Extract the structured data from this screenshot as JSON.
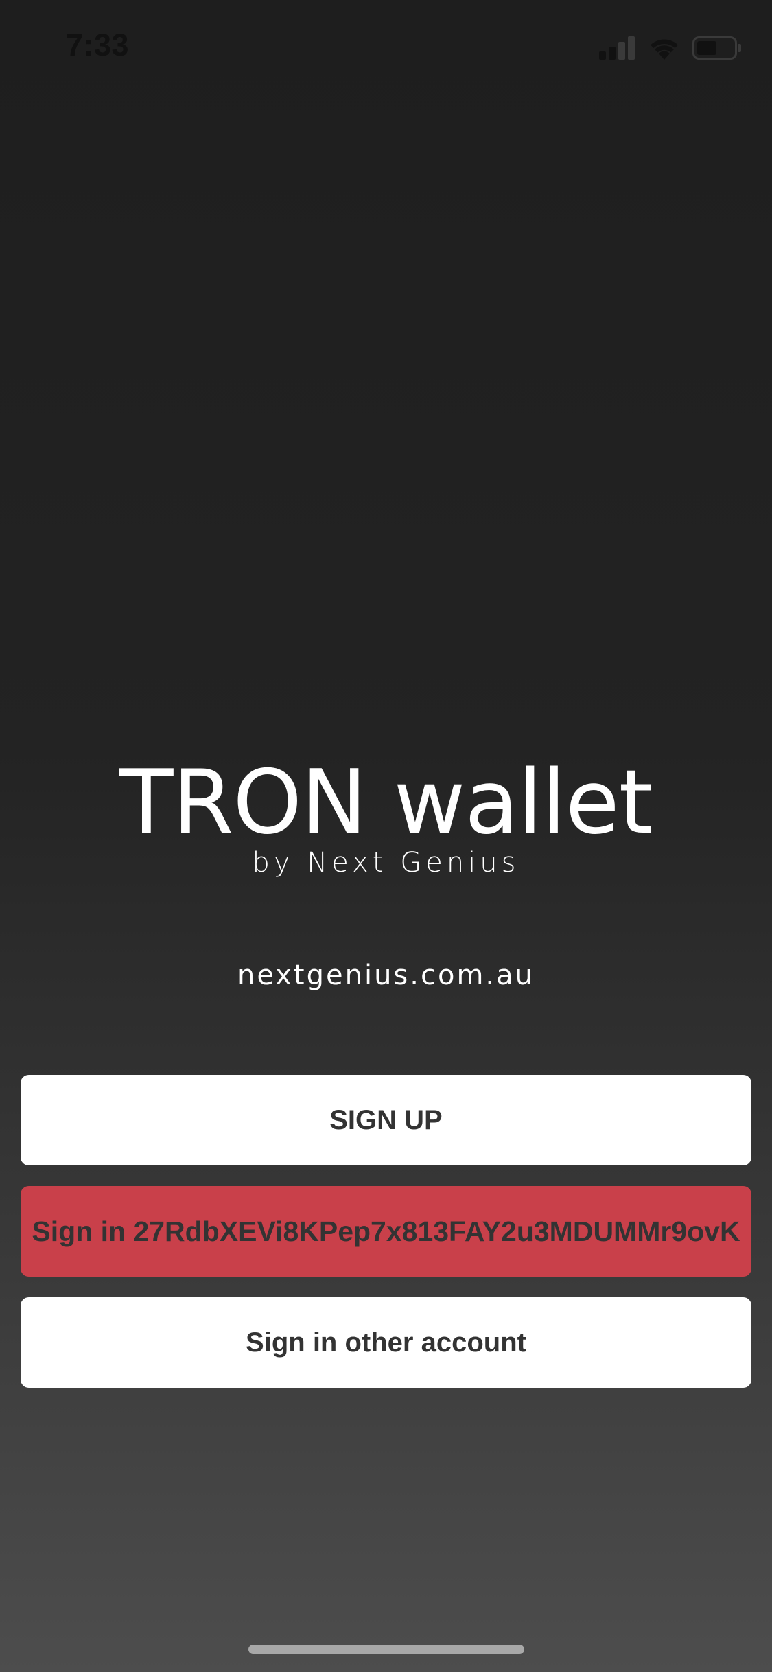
{
  "status_bar": {
    "time": "7:33",
    "icons": [
      "signal-icon",
      "wifi-icon",
      "battery-icon"
    ]
  },
  "brand": {
    "title": "TRON wallet",
    "subtitle": "by Next Genius"
  },
  "website": "nextgenius.com.au",
  "buttons": {
    "sign_up": "SIGN UP",
    "sign_in_saved": "Sign in 27RdbXEVi8KPep7x813FAY2u3MDUMMr9ovK",
    "sign_in_other": "Sign in other account"
  },
  "colors": {
    "background_top": "#1e1e1e",
    "background_bottom": "#4d4d4d",
    "accent_red": "#c9404a",
    "button_white": "#ffffff",
    "button_text": "#333333"
  }
}
